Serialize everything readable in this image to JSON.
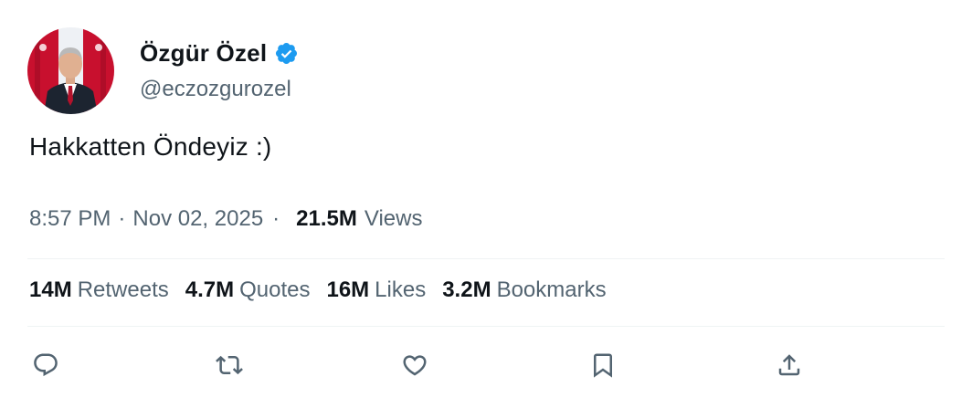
{
  "author": {
    "display_name": "Özgür Özel",
    "handle": "@eczozgurozel",
    "verified_icon": "verified-badge-icon",
    "verified_color": "#1d9bf0"
  },
  "tweet": {
    "text": "Hakkatten Öndeyiz :)",
    "time": "8:57 PM",
    "date": "Nov 02, 2025",
    "views_count": "21.5M",
    "views_label": "Views"
  },
  "stats": [
    {
      "count": "14M",
      "label": "Retweets"
    },
    {
      "count": "4.7M",
      "label": "Quotes"
    },
    {
      "count": "16M",
      "label": "Likes"
    },
    {
      "count": "3.2M",
      "label": "Bookmarks"
    }
  ],
  "actions": [
    "reply-icon",
    "retweet-icon",
    "like-icon",
    "bookmark-icon",
    "share-icon"
  ],
  "colors": {
    "text_primary": "#0f1419",
    "text_secondary": "#536471",
    "divider": "#eff3f4",
    "accent": "#1d9bf0"
  }
}
